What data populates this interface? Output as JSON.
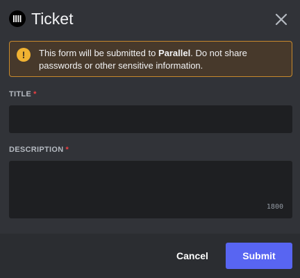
{
  "modal": {
    "title": "Ticket",
    "app_icon": "parallel-logo-icon",
    "close_icon": "close-icon"
  },
  "notice": {
    "icon": "warning-icon",
    "icon_glyph": "!",
    "text_before": "This form will be submitted to ",
    "app_name": "Parallel",
    "text_after": ". Do not share passwords or other sensitive information."
  },
  "form": {
    "title_label": "TITLE",
    "title_required": "*",
    "title_value": "",
    "description_label": "DESCRIPTION",
    "description_required": "*",
    "description_value": "",
    "description_counter": "1800"
  },
  "footer": {
    "cancel_label": "Cancel",
    "submit_label": "Submit"
  },
  "colors": {
    "background": "#313338",
    "footer": "#2b2d31",
    "input": "#1e1f22",
    "accent": "#5865f2",
    "warning": "#f0b232",
    "required": "#f23f43"
  }
}
